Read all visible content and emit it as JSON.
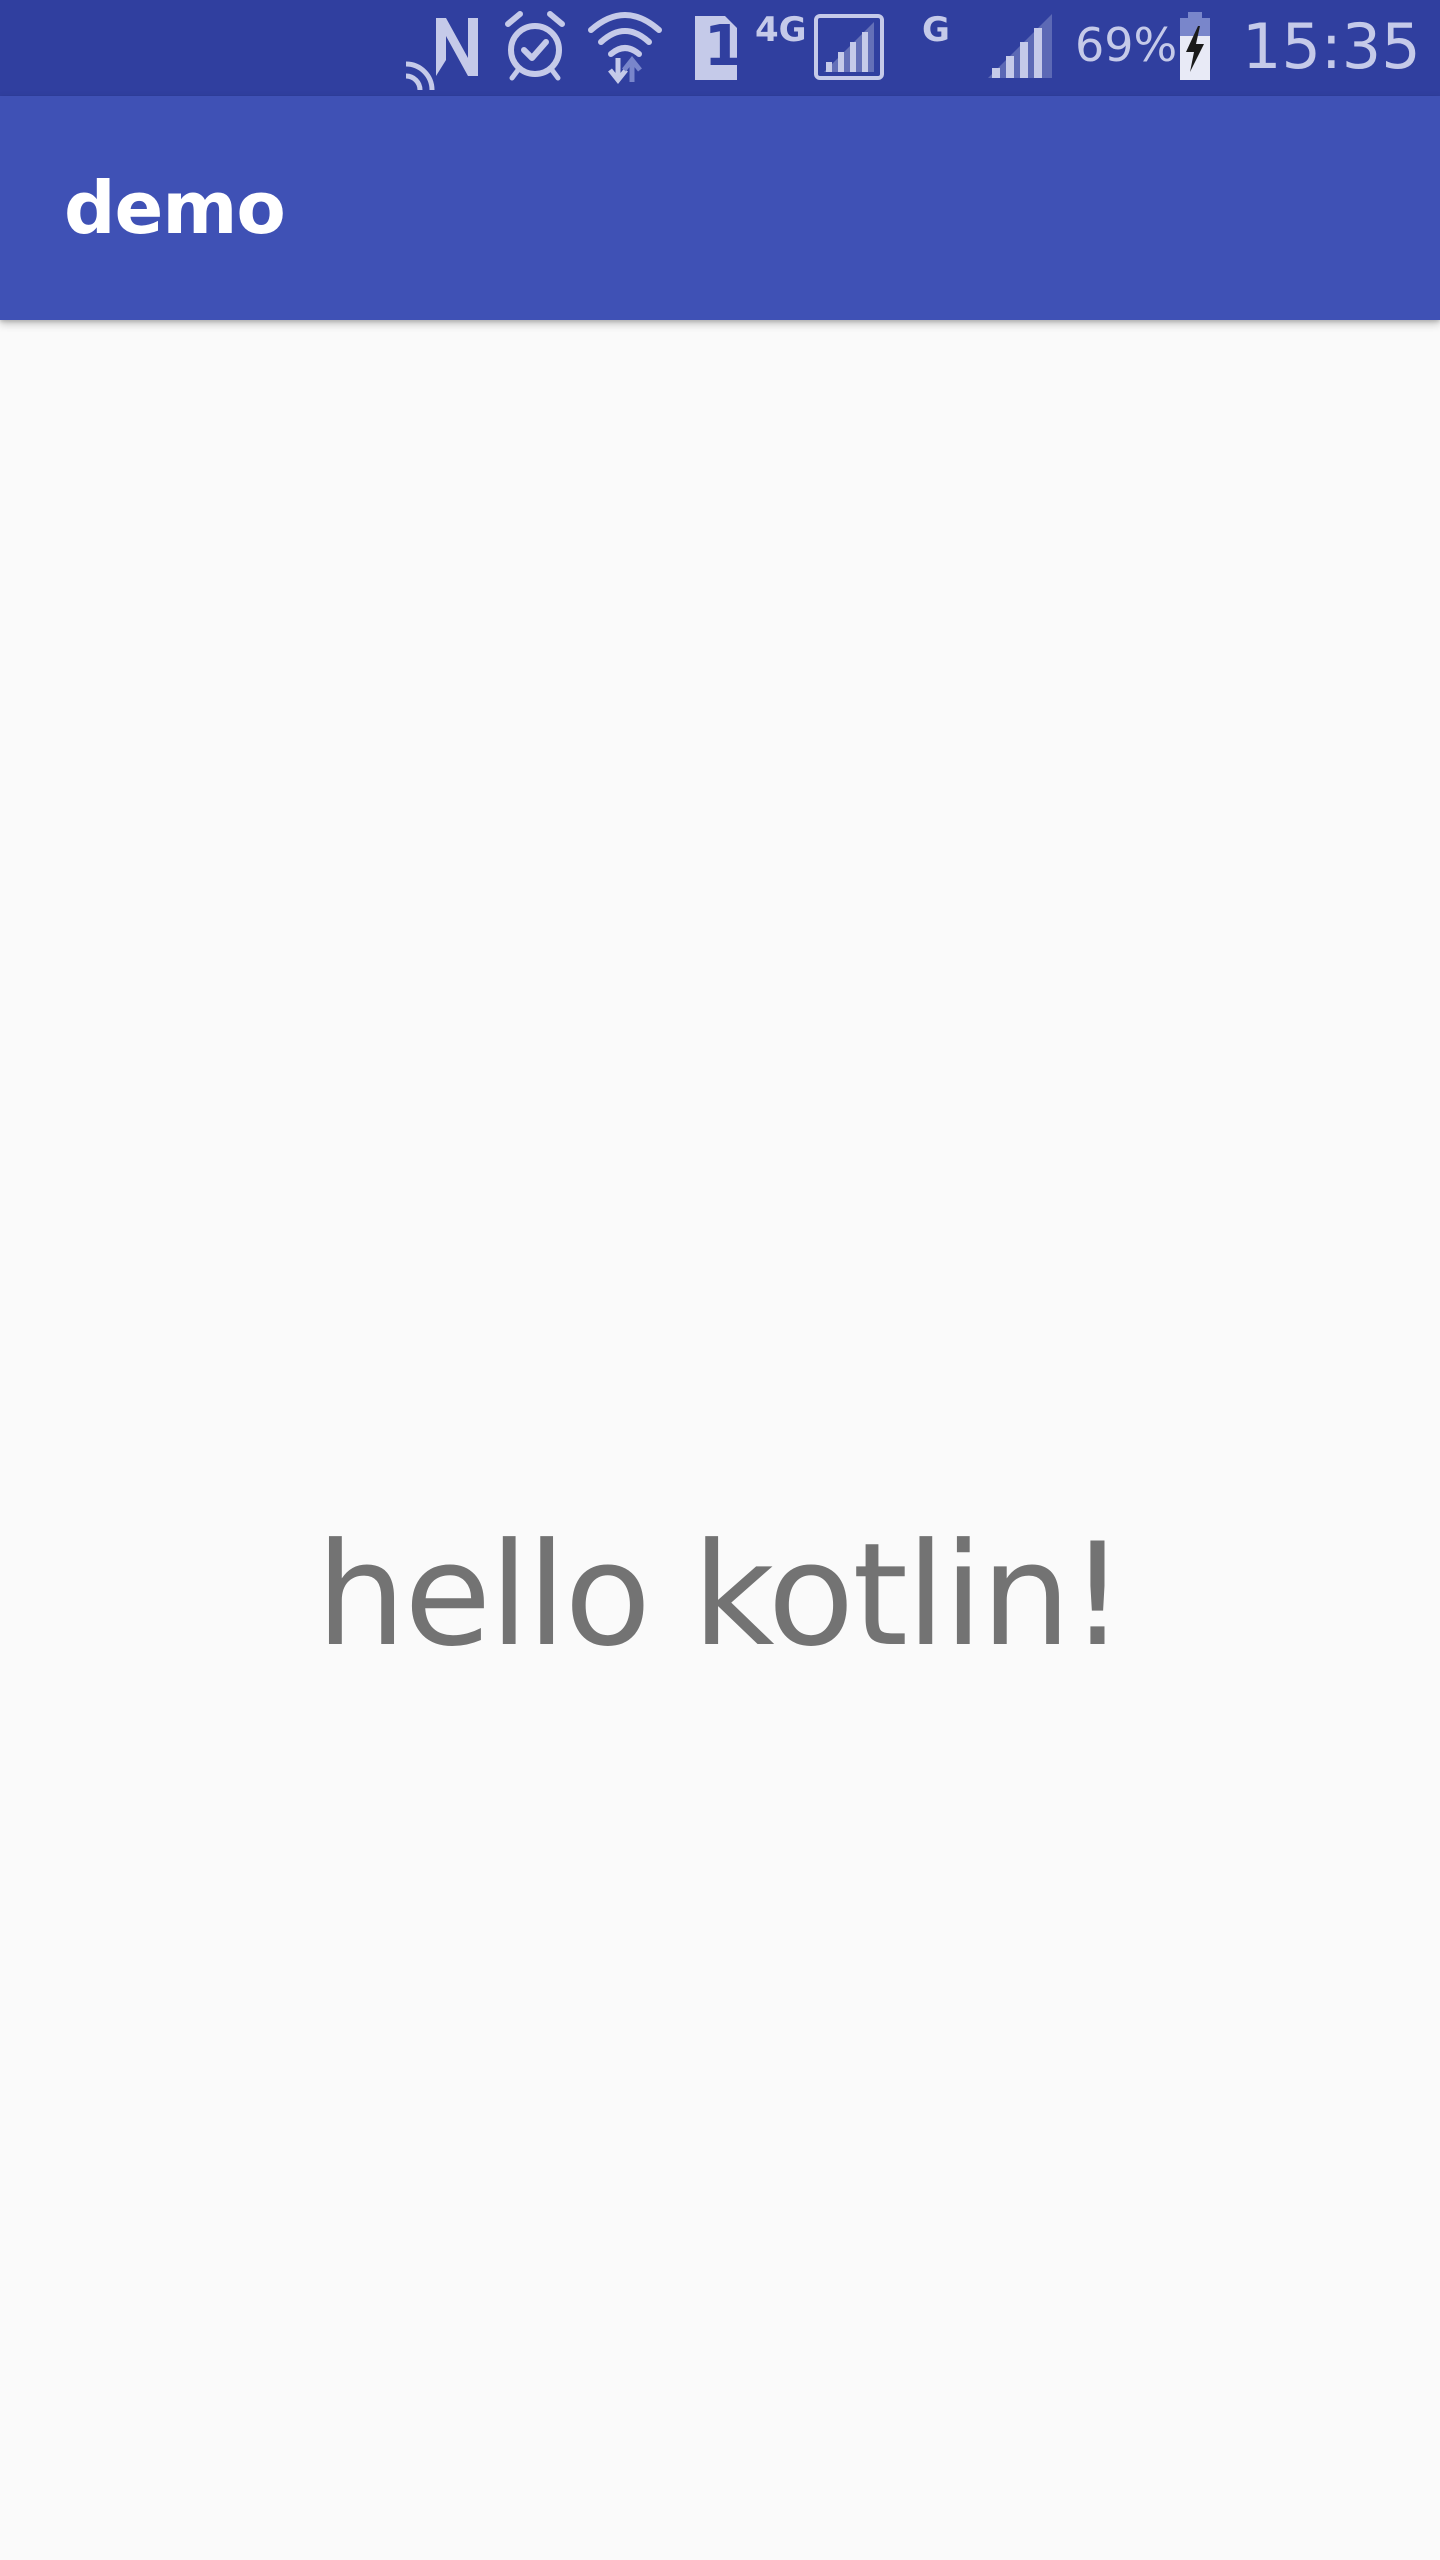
{
  "status_bar": {
    "network_type_4g": "4G",
    "network_type_g": "G",
    "sim_slot": "1",
    "battery_percent": "69%",
    "time": "15:35",
    "background_color": "#303f9f",
    "icon_color": "#c5cae9",
    "icons": [
      "nfc-icon",
      "alarm-icon",
      "wifi-icon",
      "sim-card-icon",
      "signal-4g-icon",
      "signal-g-icon",
      "battery-charging-icon"
    ]
  },
  "app_bar": {
    "title": "demo",
    "background_color": "#3f51b5"
  },
  "main": {
    "message": "hello kotlin!",
    "text_color": "#737373",
    "background_color": "#fafafa"
  }
}
